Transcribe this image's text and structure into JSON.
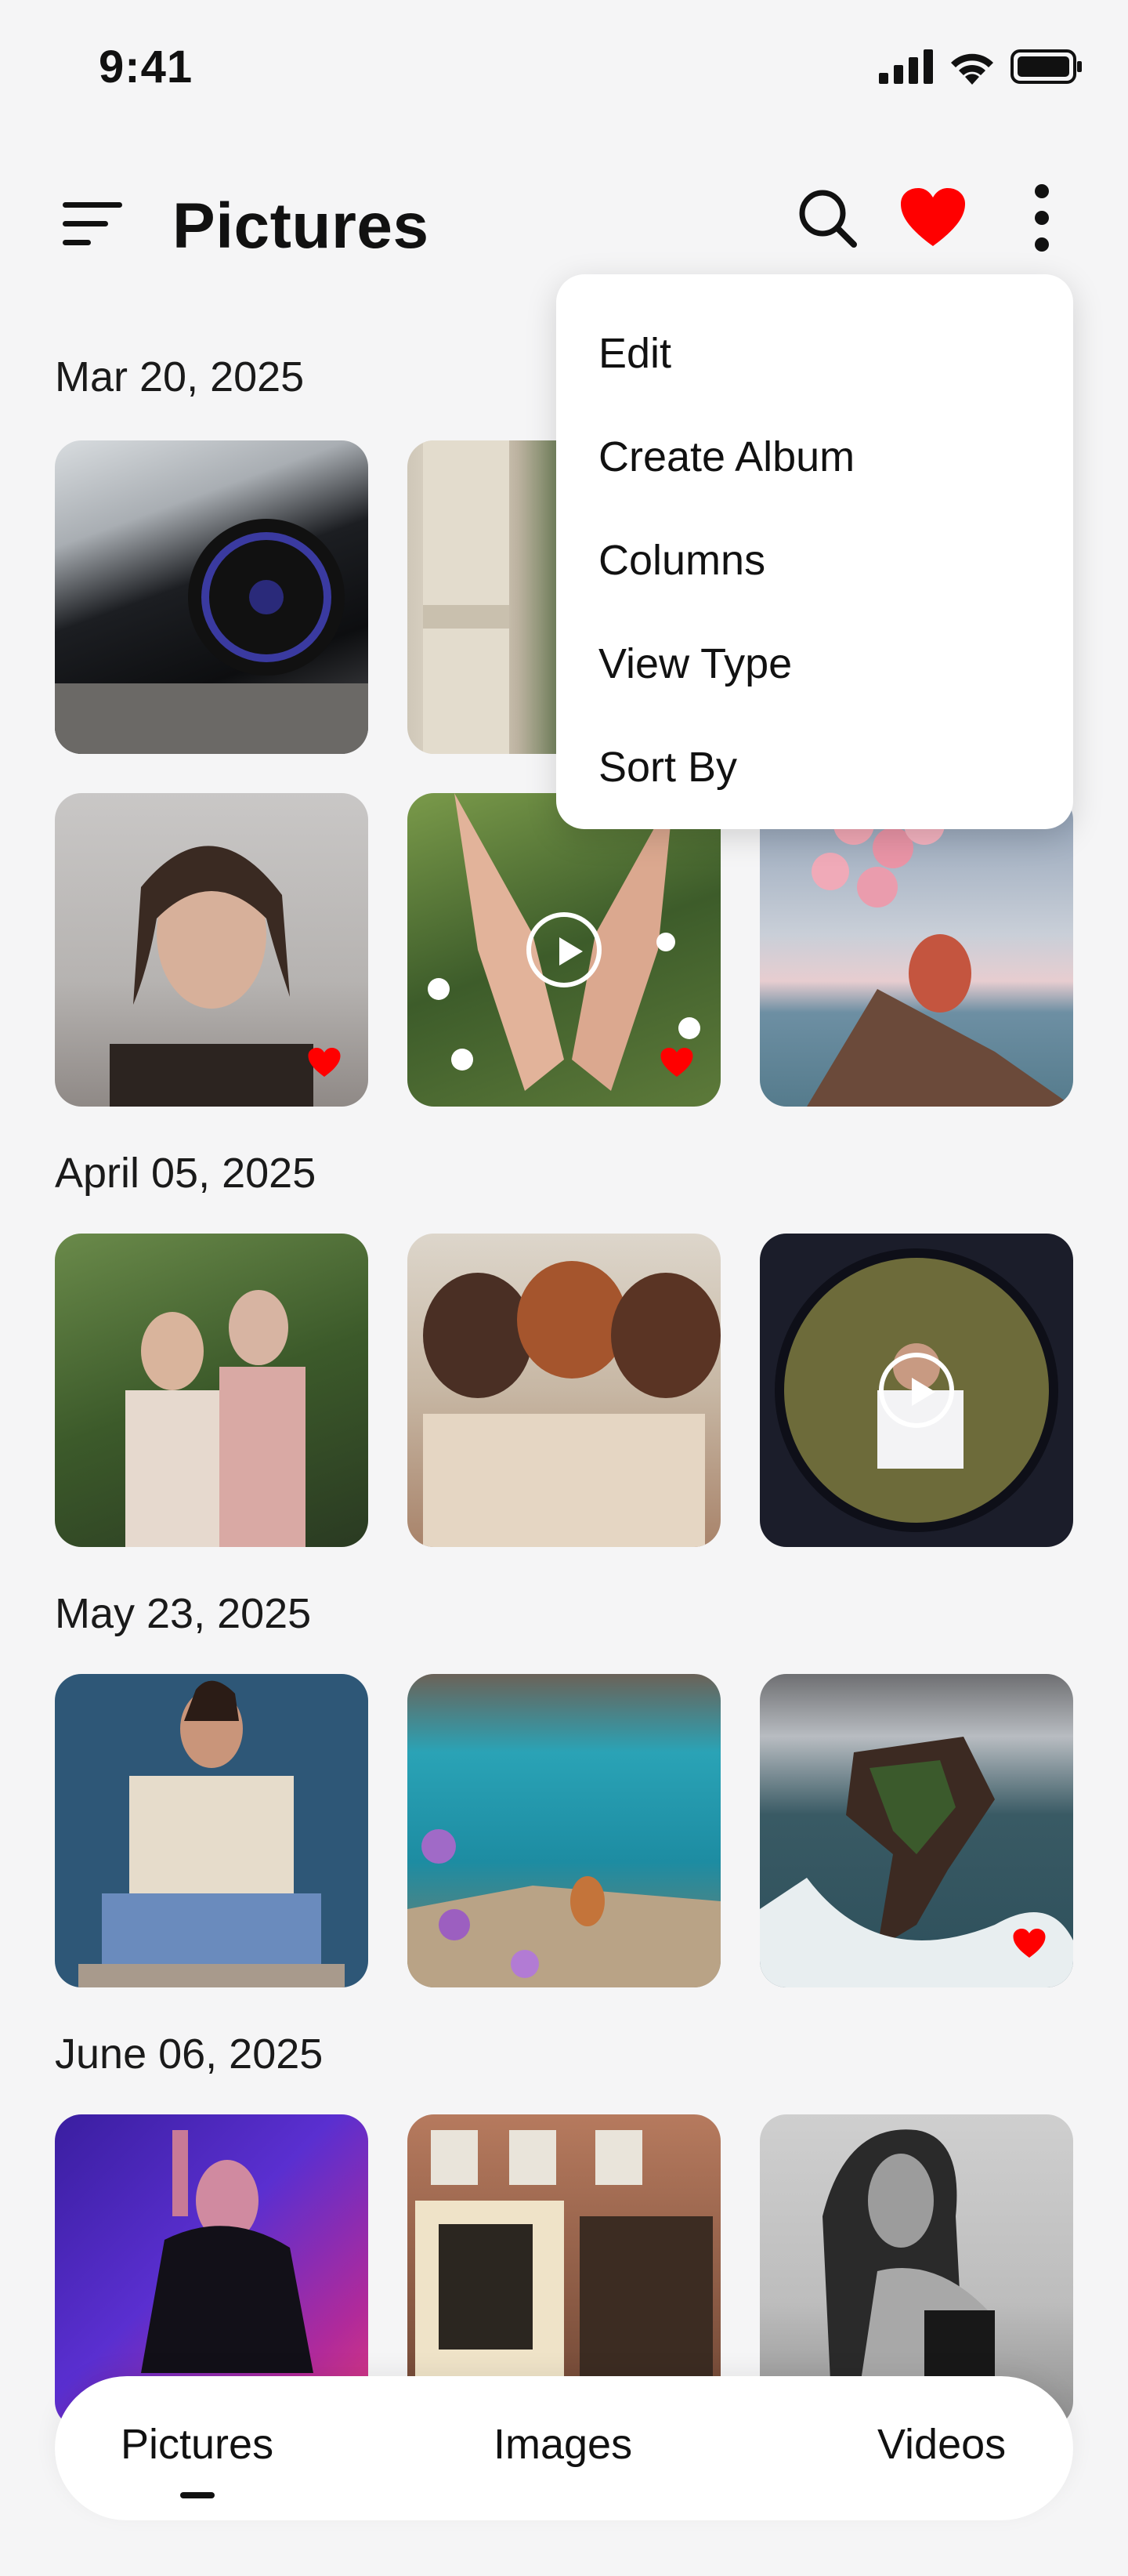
{
  "status_bar": {
    "time": "9:41"
  },
  "header": {
    "title": "Pictures"
  },
  "menu": {
    "items": [
      "Edit",
      "Create Album",
      "Columns",
      "View Type",
      "Sort By"
    ]
  },
  "sections": [
    {
      "date": "Mar 20, 2025"
    },
    {
      "date": "April 05, 2025"
    },
    {
      "date": "May 23, 2025"
    },
    {
      "date": "June 06, 2025"
    }
  ],
  "photos": [
    {
      "subject": "black sports car wheel",
      "favorite": false,
      "video": false
    },
    {
      "subject": "stone column",
      "favorite": false,
      "video": false
    },
    {
      "subject": "woman portrait",
      "favorite": true,
      "video": false
    },
    {
      "subject": "feet in daisies",
      "favorite": true,
      "video": true
    },
    {
      "subject": "pink balloons by sea",
      "favorite": false,
      "video": false
    },
    {
      "subject": "couple with drinks",
      "favorite": false,
      "video": false
    },
    {
      "subject": "friends hugging",
      "favorite": false,
      "video": false
    },
    {
      "subject": "fisheye hand",
      "favorite": false,
      "video": true
    },
    {
      "subject": "man sitting",
      "favorite": false,
      "video": false
    },
    {
      "subject": "turquoise lake cliff",
      "favorite": false,
      "video": false
    },
    {
      "subject": "sea cliff waves",
      "favorite": true,
      "video": false
    },
    {
      "subject": "dancer neon",
      "favorite": false,
      "video": false
    },
    {
      "subject": "brick building",
      "favorite": false,
      "video": false
    },
    {
      "subject": "black and white portrait",
      "favorite": false,
      "video": false
    }
  ],
  "bottom_nav": {
    "tabs": [
      "Pictures",
      "Images",
      "Videos"
    ],
    "active": "Pictures"
  },
  "colors": {
    "accent": "#ff0000",
    "background": "#f5f5f6"
  }
}
